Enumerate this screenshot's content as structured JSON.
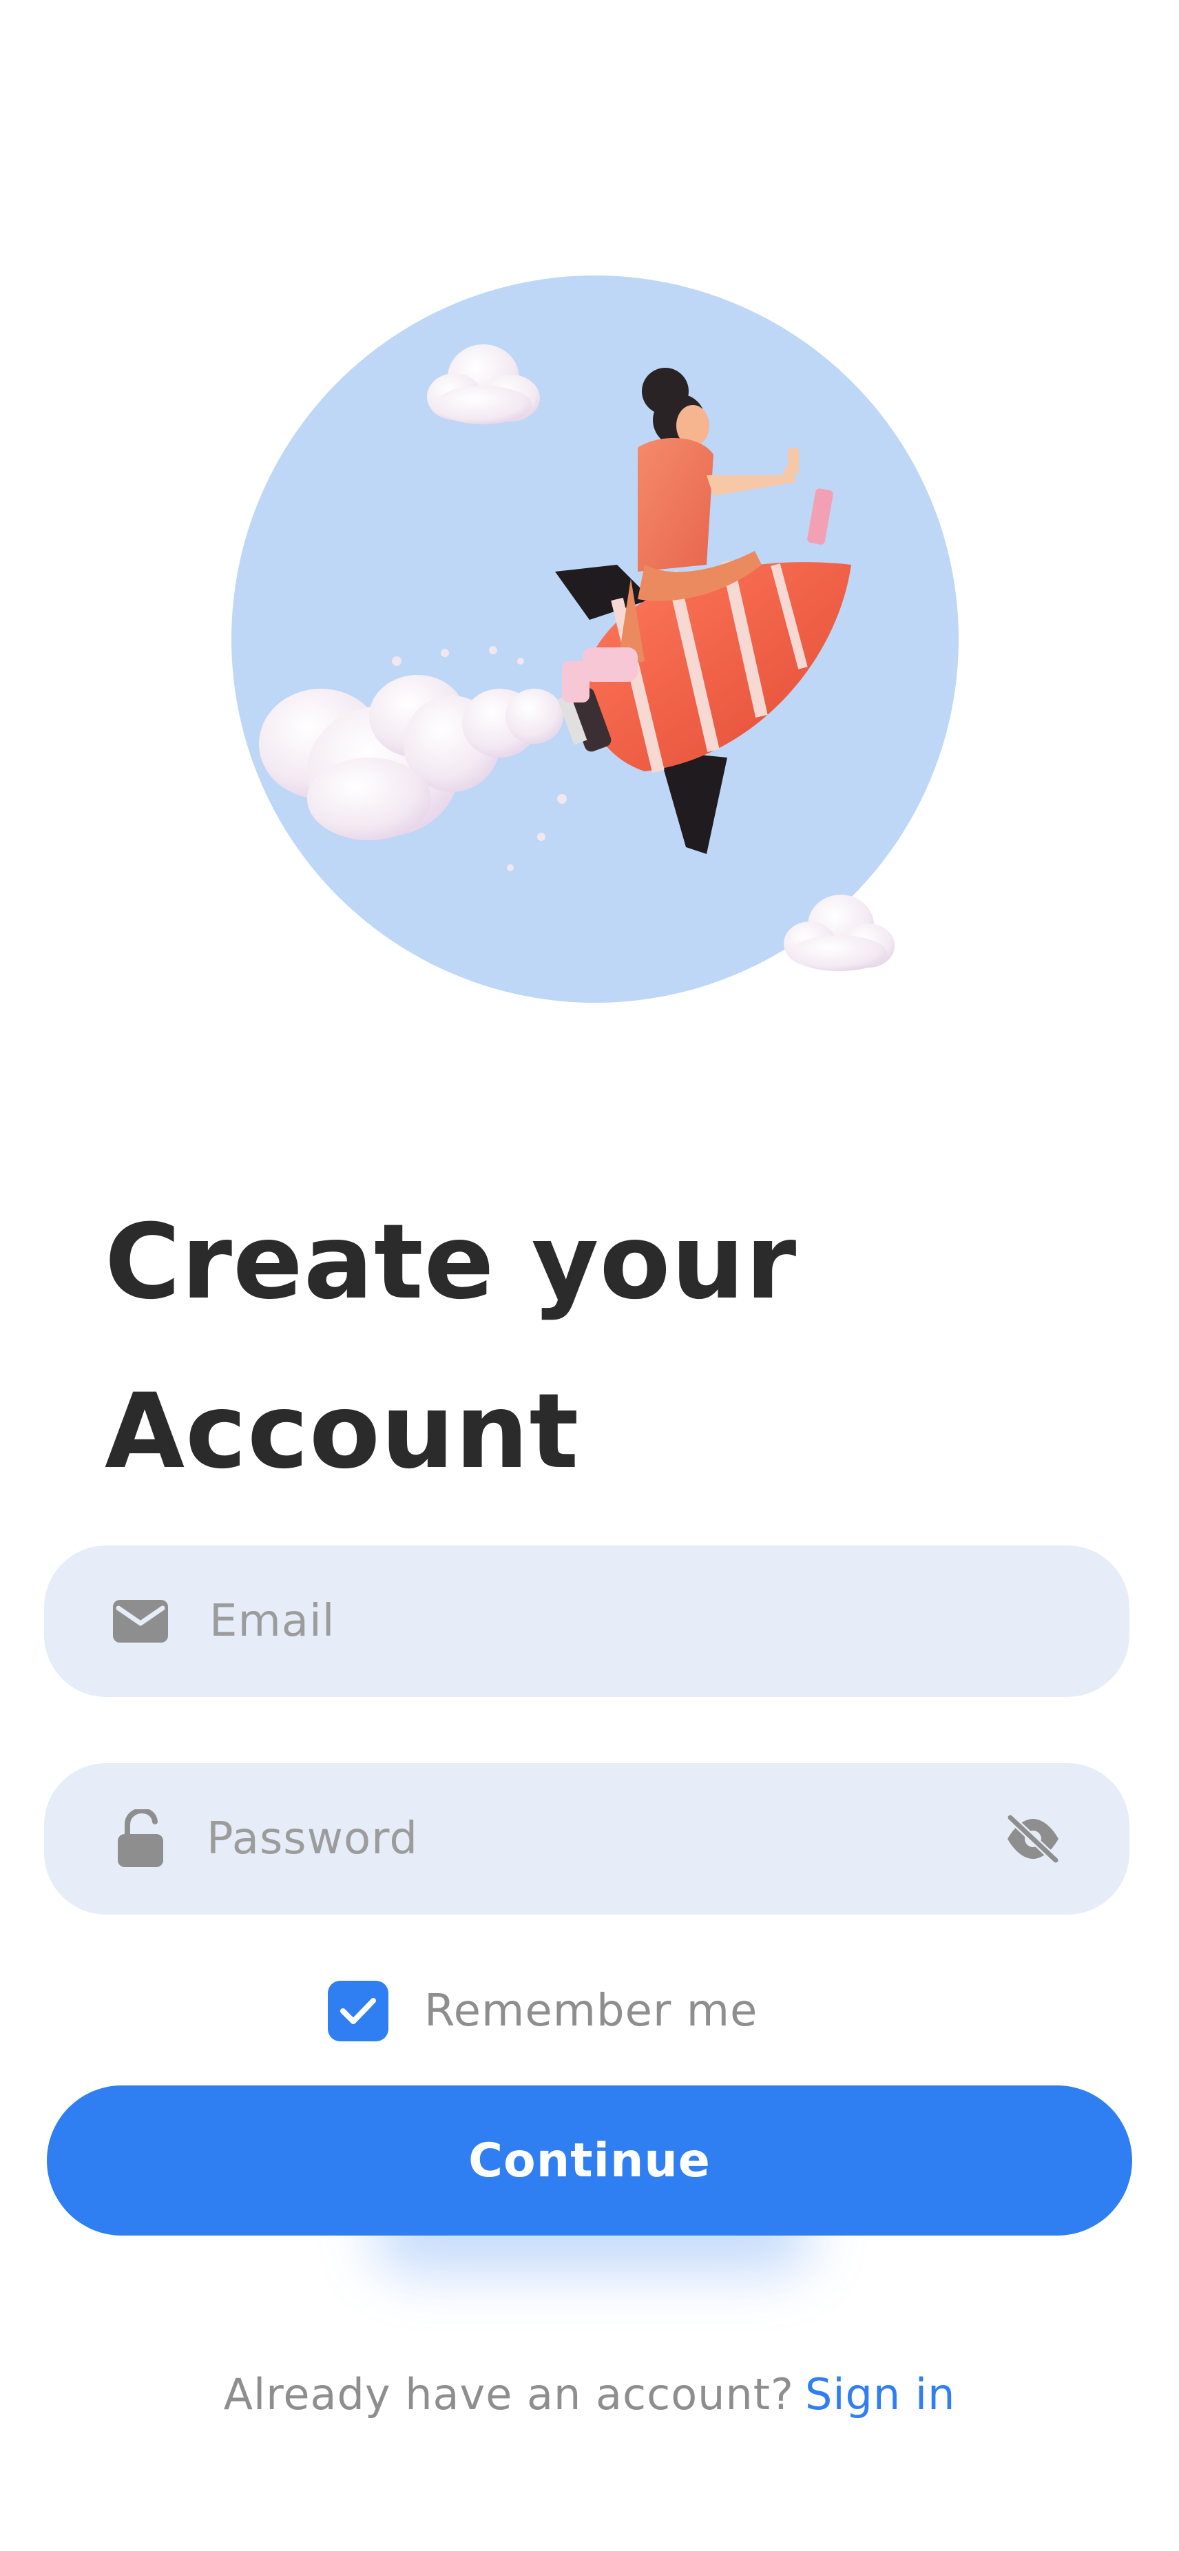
{
  "title": {
    "line1": "Create your",
    "line2": "Account"
  },
  "email": {
    "placeholder": "Email",
    "icon": "mail-icon"
  },
  "password": {
    "placeholder": "Password",
    "icon": "lock-icon",
    "toggle_icon": "eye-off-icon"
  },
  "remember": {
    "label": "Remember me",
    "checked": true
  },
  "continue_label": "Continue",
  "footer": {
    "prompt": "Already have an account?",
    "link": "Sign in"
  },
  "colors": {
    "accent": "#2f7ff2",
    "field_bg": "#e6edf8",
    "hero_bg": "#bed7f7",
    "title": "#2b2b2b",
    "muted": "#8e8e8e"
  },
  "illustration": "woman-riding-rocket-illustration"
}
